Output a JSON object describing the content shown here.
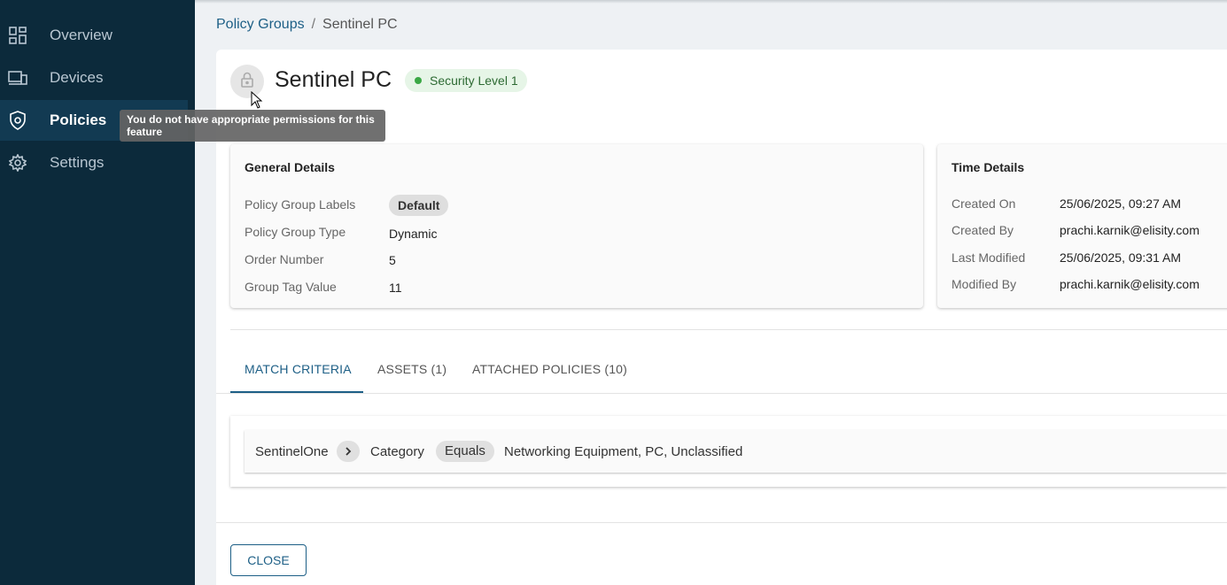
{
  "sidebar": {
    "items": [
      {
        "label": "Overview",
        "icon": "dashboard-icon"
      },
      {
        "label": "Devices",
        "icon": "devices-icon"
      },
      {
        "label": "Policies",
        "icon": "shield-icon",
        "active": true
      },
      {
        "label": "Settings",
        "icon": "gear-icon"
      }
    ]
  },
  "tooltip": {
    "text": "You do not have appropriate permissions for this feature"
  },
  "breadcrumb": {
    "parent": "Policy Groups",
    "separator": "/",
    "current": "Sentinel PC"
  },
  "header": {
    "title": "Sentinel PC",
    "badge": "Security Level 1",
    "lock_icon": "lock-icon"
  },
  "general_details": {
    "title": "General Details",
    "rows": [
      {
        "key": "Policy Group Labels",
        "value": "Default"
      },
      {
        "key": "Policy Group Type",
        "value": "Dynamic"
      },
      {
        "key": "Order Number",
        "value": "5"
      },
      {
        "key": "Group Tag Value",
        "value": "11"
      }
    ]
  },
  "time_details": {
    "title": "Time Details",
    "rows": [
      {
        "key": "Created On",
        "value": "25/06/2025, 09:27 AM"
      },
      {
        "key": "Created By",
        "value": "prachi.karnik@elisity.com"
      },
      {
        "key": "Last Modified",
        "value": "25/06/2025, 09:31 AM"
      },
      {
        "key": "Modified By",
        "value": "prachi.karnik@elisity.com"
      }
    ]
  },
  "tabs": [
    {
      "label": "MATCH CRITERIA",
      "active": true
    },
    {
      "label": "ASSETS (1)"
    },
    {
      "label": "ATTACHED POLICIES (10)"
    }
  ],
  "criteria": {
    "source": "SentinelOne",
    "attribute": "Category",
    "operator": "Equals",
    "values": "Networking Equipment, PC, Unclassified"
  },
  "footer": {
    "close_label": "CLOSE"
  },
  "colors": {
    "sidebar_bg": "#0c2a3b",
    "accent": "#1d5f86",
    "badge_green": "#3aa845"
  }
}
